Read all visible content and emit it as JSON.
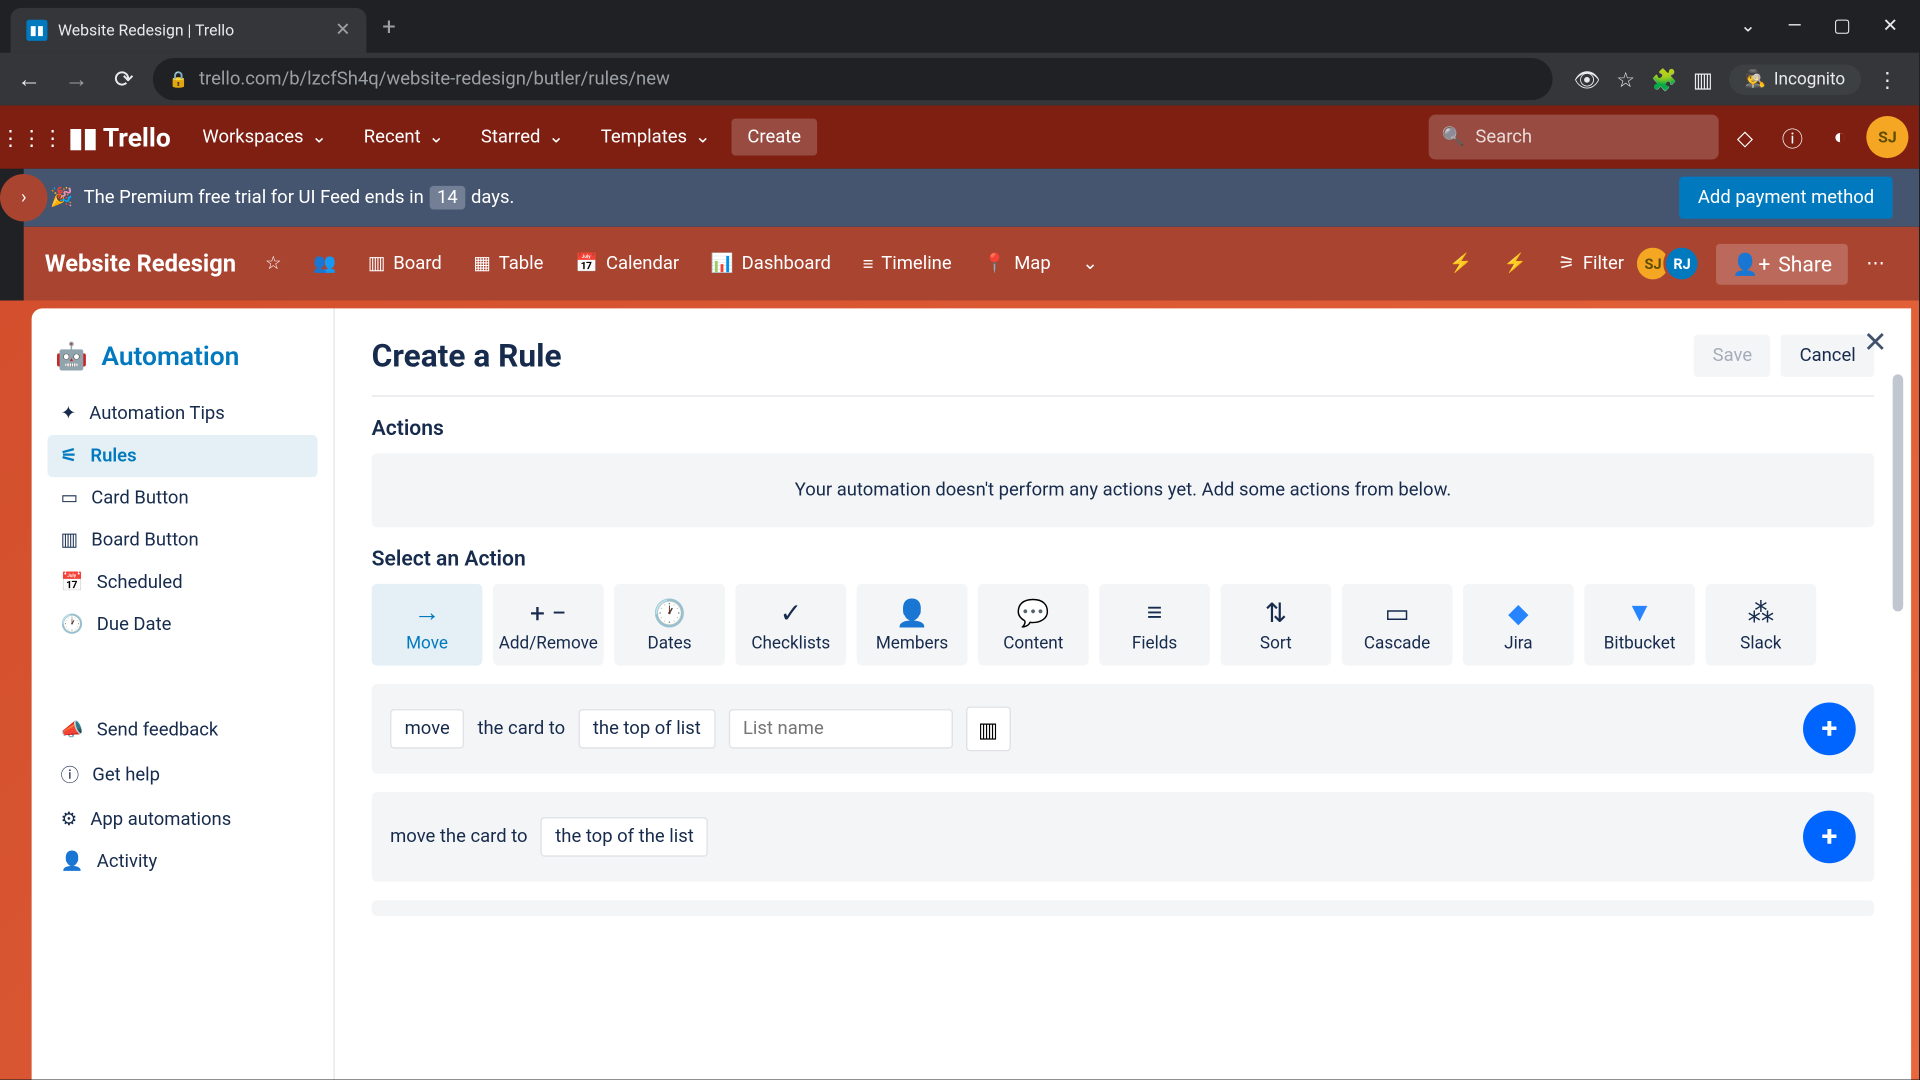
{
  "browser": {
    "tab_title": "Website Redesign | Trello",
    "url": "trello.com/b/lzcfSh4q/website-redesign/butler/rules/new",
    "incognito_label": "Incognito"
  },
  "header": {
    "logo": "Trello",
    "nav": {
      "workspaces": "Workspaces",
      "recent": "Recent",
      "starred": "Starred",
      "templates": "Templates",
      "create": "Create"
    },
    "search_placeholder": "Search"
  },
  "premium": {
    "text_before": "The Premium free trial for UI Feed ends in",
    "days": "14",
    "text_after": "days.",
    "add_payment": "Add payment method"
  },
  "board": {
    "title": "Website Redesign",
    "views": {
      "board": "Board",
      "table": "Table",
      "calendar": "Calendar",
      "dashboard": "Dashboard",
      "timeline": "Timeline",
      "map": "Map"
    },
    "filter": "Filter",
    "share": "Share",
    "members": {
      "sj": "SJ",
      "rj": "RJ"
    }
  },
  "sidebar": {
    "title": "Automation",
    "items": {
      "tips": "Automation Tips",
      "rules": "Rules",
      "card_button": "Card Button",
      "board_button": "Board Button",
      "scheduled": "Scheduled",
      "due_date": "Due Date",
      "feedback": "Send feedback",
      "help": "Get help",
      "app_auto": "App automations",
      "activity": "Activity"
    }
  },
  "panel": {
    "title": "Create a Rule",
    "save": "Save",
    "cancel": "Cancel",
    "actions_label": "Actions",
    "empty_text": "Your automation doesn't perform any actions yet. Add some actions from below.",
    "select_label": "Select an Action",
    "tabs": {
      "move": "Move",
      "add_remove": "Add/Remove",
      "dates": "Dates",
      "checklists": "Checklists",
      "members": "Members",
      "content": "Content",
      "fields": "Fields",
      "sort": "Sort",
      "cascade": "Cascade",
      "jira": "Jira",
      "bitbucket": "Bitbucket",
      "slack": "Slack"
    },
    "row1": {
      "move": "move",
      "card_to": "the card to",
      "top_of_list": "the top of list",
      "list_placeholder": "List name"
    },
    "row2": {
      "move_card_to": "move the card to",
      "top_of_the_list": "the top of the list"
    }
  }
}
